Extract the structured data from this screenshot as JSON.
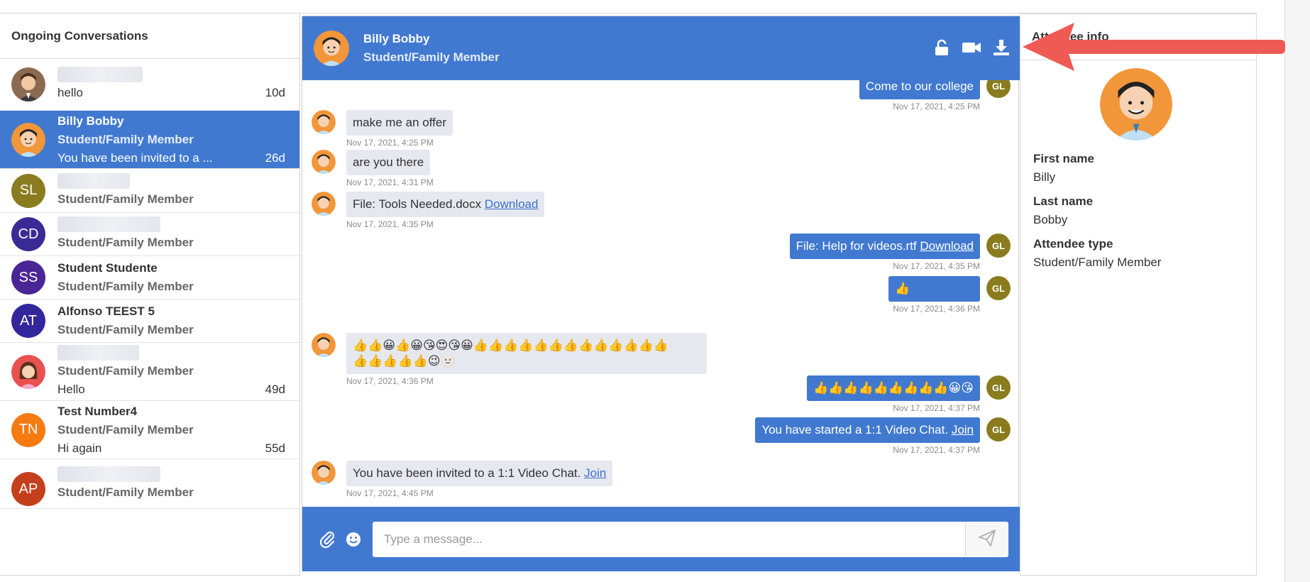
{
  "sidebar": {
    "title": "Ongoing Conversations",
    "conversations": [
      {
        "name": "",
        "type": "",
        "message": "hello",
        "time": "10d",
        "initials": ""
      },
      {
        "name": "Billy Bobby",
        "type": "Student/Family Member",
        "message": "You have been invited to a ...",
        "time": "26d",
        "initials": ""
      },
      {
        "name": "",
        "type": "Student/Family Member",
        "message": "",
        "time": "",
        "initials": "SL"
      },
      {
        "name": "",
        "type": "Student/Family Member",
        "message": "",
        "time": "",
        "initials": "CD"
      },
      {
        "name": "Student Studente",
        "type": "Student/Family Member",
        "message": "",
        "time": "",
        "initials": "SS"
      },
      {
        "name": "Alfonso TEEST 5",
        "type": "Student/Family Member",
        "message": "",
        "time": "",
        "initials": "AT"
      },
      {
        "name": "",
        "type": "Student/Family Member",
        "message": "Hello",
        "time": "49d",
        "initials": ""
      },
      {
        "name": "Test Number4",
        "type": "Student/Family Member",
        "message": "Hi again",
        "time": "55d",
        "initials": "TN"
      },
      {
        "name": "",
        "type": "Student/Family Member",
        "message": "",
        "time": "",
        "initials": "AP"
      }
    ]
  },
  "chat": {
    "header": {
      "name": "Billy Bobby",
      "type": "Student/Family Member"
    },
    "messages": [
      {
        "text": "Come to our college",
        "time": "Nov 17, 2021, 4:25 PM",
        "avatar": "GL"
      },
      {
        "text": "make me an offer",
        "time": "Nov 17, 2021, 4:25 PM"
      },
      {
        "text": "are you there",
        "time": "Nov 17, 2021, 4:31 PM"
      },
      {
        "text": "File: Tools Needed.docx",
        "link": "Download",
        "time": "Nov 17, 2021, 4:35 PM"
      },
      {
        "text": "File: Help for videos.rtf",
        "link": "Download",
        "time": "Nov 17, 2021, 4:35 PM",
        "avatar": "GL"
      },
      {
        "text": "👍",
        "time": "Nov 17, 2021, 4:36 PM",
        "avatar": "GL"
      },
      {
        "text": "👍👍😀👍😀😘😍😘😀👍👍👍👍👍👍👍👍👍👍👍👍👍",
        "text2": "👍👍👍👍👍😉🫥",
        "time": "Nov 17, 2021, 4:36 PM"
      },
      {
        "text": "👍👍👍👍👍👍👍👍👍😀😘",
        "time": "Nov 17, 2021, 4:37 PM",
        "avatar": "GL"
      },
      {
        "text": "You have started a 1:1 Video Chat.",
        "link": "Join",
        "time": "Nov 17, 2021, 4:37 PM",
        "avatar": "GL"
      },
      {
        "text": "You have been invited to a 1:1 Video Chat.",
        "link": "Join",
        "time": "Nov 17, 2021, 4:45 PM"
      }
    ],
    "composer": {
      "placeholder": "Type a message..."
    }
  },
  "info": {
    "title": "Attendee info",
    "first_name_label": "First name",
    "first_name": "Billy",
    "last_name_label": "Last name",
    "last_name": "Bobby",
    "type_label": "Attendee type",
    "type": "Student/Family Member"
  },
  "colors": {
    "accent": "#4179d1",
    "avatar_sl": "#8a7c1e",
    "avatar_cd": "#3a2a96",
    "avatar_ss": "#4a2596",
    "avatar_at": "#33279b",
    "avatar_tn": "#f57a12",
    "avatar_ap": "#c4401c",
    "arrow": "#f05a54"
  },
  "icons": [
    "lock-open-icon",
    "video-camera-icon",
    "download-icon",
    "paperclip-icon",
    "smiley-icon",
    "send-icon"
  ]
}
